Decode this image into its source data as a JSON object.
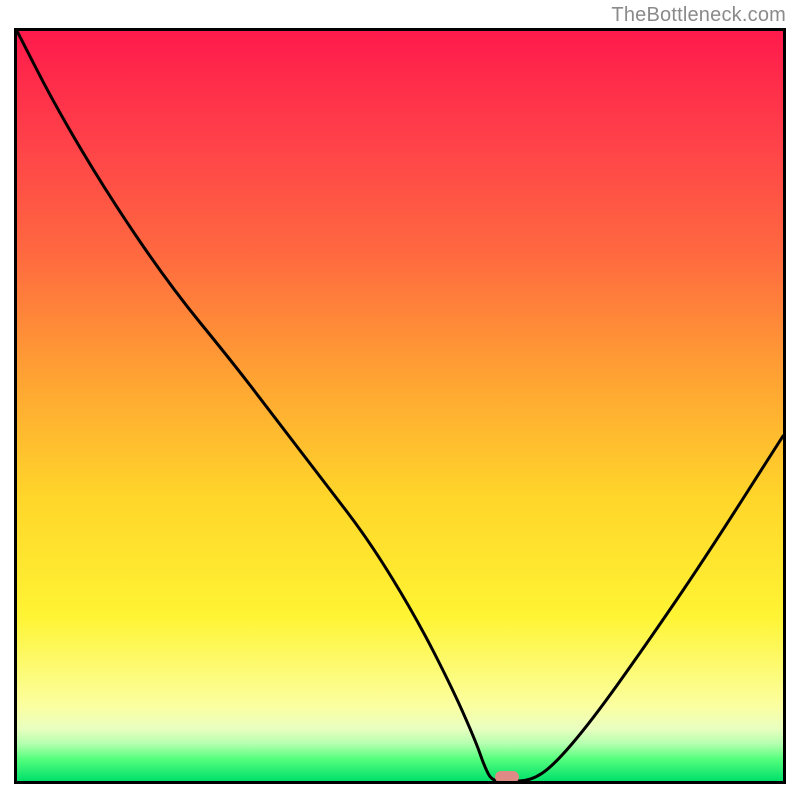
{
  "watermark": {
    "text": "TheBottleneck.com"
  },
  "colors": {
    "frame_border": "#000000",
    "curve_stroke": "#000000",
    "marker_fill": "#e08a86",
    "gradient_stops": [
      {
        "pct": 0,
        "hex": "#ff1a4b"
      },
      {
        "pct": 14,
        "hex": "#ff3f4a"
      },
      {
        "pct": 30,
        "hex": "#ff6a3f"
      },
      {
        "pct": 46,
        "hex": "#ffa233"
      },
      {
        "pct": 62,
        "hex": "#ffd52a"
      },
      {
        "pct": 78,
        "hex": "#fff433"
      },
      {
        "pct": 90,
        "hex": "#fbffa0"
      },
      {
        "pct": 93,
        "hex": "#e9ffc0"
      },
      {
        "pct": 95,
        "hex": "#b6ffb0"
      },
      {
        "pct": 97,
        "hex": "#57ff7e"
      },
      {
        "pct": 100,
        "hex": "#00e06a"
      }
    ]
  },
  "chart_data": {
    "type": "line",
    "title": "",
    "xlabel": "",
    "ylabel": "",
    "xlim": [
      0,
      100
    ],
    "ylim": [
      0,
      100
    ],
    "x": [
      0,
      5,
      12,
      20,
      28,
      34,
      40,
      46,
      52,
      57,
      60,
      61,
      62,
      64,
      67,
      70,
      75,
      82,
      90,
      100
    ],
    "values": [
      100,
      90,
      78,
      66,
      56,
      48,
      40,
      32,
      22,
      12,
      5,
      2,
      0,
      0,
      0,
      2,
      8,
      18,
      30,
      46
    ],
    "marker_x": 64,
    "legend": false,
    "grid": false
  }
}
